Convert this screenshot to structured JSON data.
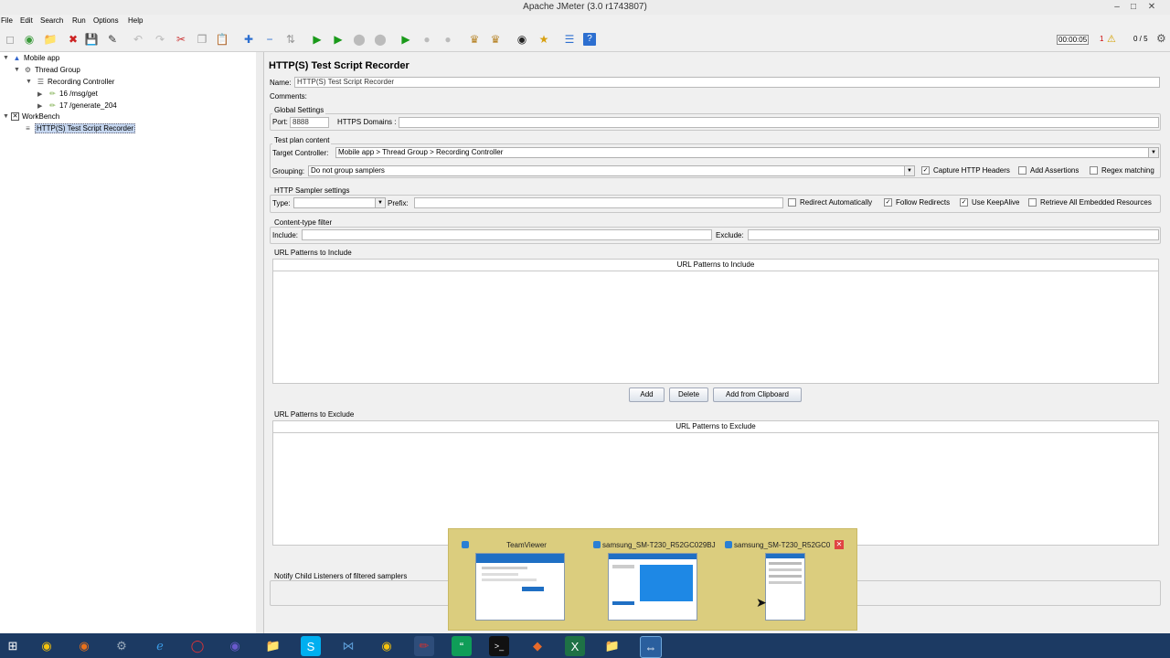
{
  "window": {
    "title": "Apache JMeter (3.0 r1743807)"
  },
  "menu": [
    "File",
    "Edit",
    "Search",
    "Run",
    "Options",
    "Help"
  ],
  "status": {
    "elapsed": "00:00:05",
    "errors": "1",
    "threads": "0 / 5"
  },
  "tree": {
    "mobile_app": "Mobile app",
    "thread_group": "Thread Group",
    "recording_controller": "Recording Controller",
    "sampler1": "16 /msg/get",
    "sampler2": "17 /generate_204",
    "workbench": "WorkBench",
    "recorder": "HTTP(S) Test Script Recorder"
  },
  "panel": {
    "heading": "HTTP(S) Test Script Recorder",
    "name_label": "Name:",
    "name_value": "HTTP(S) Test Script Recorder",
    "comments_label": "Comments:",
    "global": {
      "title": "Global Settings",
      "port_label": "Port:",
      "port_value": "8888",
      "https_label": "HTTPS Domains :",
      "https_value": ""
    },
    "plan": {
      "title": "Test plan content",
      "target_label": "Target Controller:",
      "target_value": "Mobile app > Thread Group > Recording Controller",
      "grouping_label": "Grouping:",
      "grouping_value": "Do not group samplers",
      "capture_headers": "Capture HTTP Headers",
      "add_assertions": "Add Assertions",
      "regex_matching": "Regex matching"
    },
    "sampler": {
      "title": "HTTP Sampler settings",
      "type_label": "Type:",
      "type_value": "",
      "prefix_label": "Prefix:",
      "prefix_value": "",
      "redirect_auto": "Redirect Automatically",
      "follow_redirects": "Follow Redirects",
      "keepalive": "Use KeepAlive",
      "embedded": "Retrieve All Embedded Resources"
    },
    "content": {
      "title": "Content-type filter",
      "include_label": "Include:",
      "include_value": "",
      "exclude_label": "Exclude:",
      "exclude_value": ""
    },
    "include_patterns": {
      "title": "URL Patterns to Include",
      "header": "URL Patterns to Include"
    },
    "buttons": {
      "add": "Add",
      "delete": "Delete",
      "clipboard": "Add from Clipboard"
    },
    "exclude_patterns": {
      "title": "URL Patterns to Exclude",
      "header": "URL Patterns to Exclude"
    },
    "notify": {
      "title": "Notify Child Listeners of filtered samplers"
    }
  },
  "thumbnails": [
    {
      "title": "TeamViewer"
    },
    {
      "title": "samsung_SM-T230_R52GC029BJ..."
    },
    {
      "title": "samsung_SM-T230_R52GC0..."
    }
  ],
  "colors": {
    "taskbar": "#1c3a63",
    "thumb_bg": "#dbcd7e",
    "selection": "#c6d7f0"
  }
}
